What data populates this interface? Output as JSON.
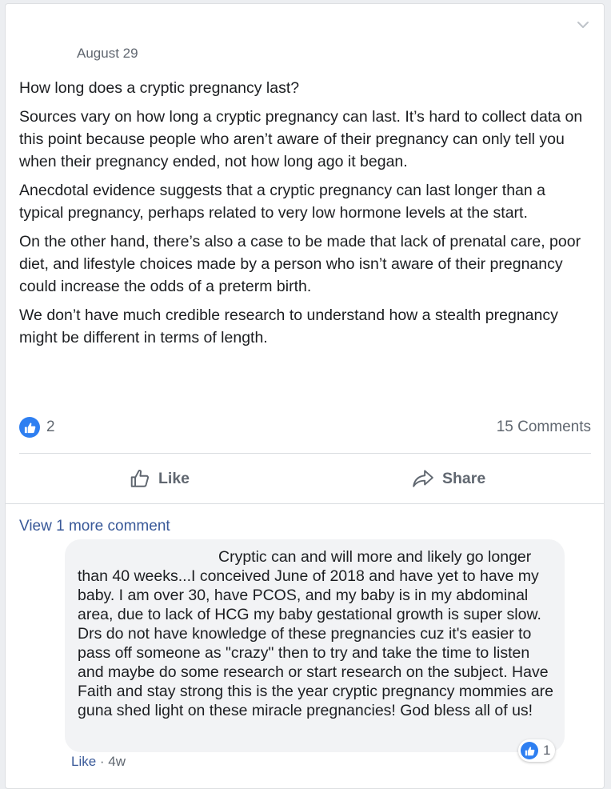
{
  "post": {
    "date": "August 29",
    "paragraphs": [
      "How long does a cryptic pregnancy last?",
      "Sources vary on how long a cryptic pregnancy can last. It’s hard to collect data on this point because people who aren’t aware of their pregnancy can only tell you when their pregnancy ended, not how long ago it began.",
      "Anecdotal evidence suggests that a cryptic pregnancy can last longer than a typical pregnancy, perhaps related to very low hormone levels at the start.",
      "On the other hand, there’s also a case to be made that lack of prenatal care, poor diet, and lifestyle choices made by a person who isn’t aware of their pregnancy could increase the odds of a preterm birth.",
      "We don’t have much credible research to understand how a stealth pregnancy might be different in terms of length."
    ],
    "reaction_count": "2",
    "comments_count": "15 Comments"
  },
  "actions": {
    "like_label": "Like",
    "share_label": "Share"
  },
  "comments": {
    "view_more_label": "View 1 more comment",
    "comment_text": "Cryptic can and will more and likely go longer than 40 weeks...I conceived June of 2018 and have yet to have my baby. I am over 30, have PCOS, and my baby is in my abdominal area, due to lack of HCG my baby gestational growth is super slow. Drs do not have knowledge of these pregnancies cuz it's easier to pass off someone as \"crazy\" then to try and take the time to listen and maybe do some research or start research on the subject. Have Faith and stay strong this is the year cryptic pregnancy mommies are guna shed light on these miracle pregnancies! God bless all of us!",
    "comment_reaction_count": "1",
    "like_link": "Like",
    "separator": " · ",
    "time": "4w"
  },
  "colors": {
    "accent": "#385898",
    "like_blue": "#2e7ff1",
    "muted": "#606770"
  }
}
